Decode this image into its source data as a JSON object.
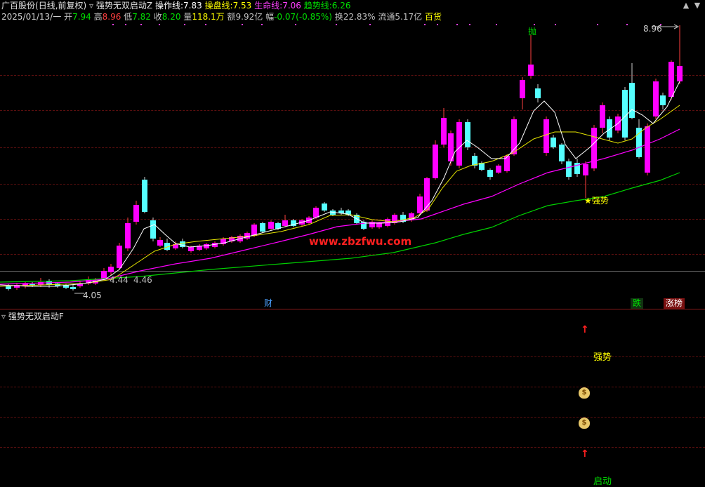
{
  "header": {
    "stock": "广百股份",
    "mode": "(日线,前复权)",
    "indicator_name": "强势无双启动Z",
    "lines": [
      {
        "label": "操作线:",
        "value": "7.83",
        "color": "#ffffff"
      },
      {
        "label": "操盘线:",
        "value": "7.53",
        "color": "#ffff00"
      },
      {
        "label": "生命线:",
        "value": "7.06",
        "color": "#ff40ff"
      },
      {
        "label": "趋势线:",
        "value": "6.26",
        "color": "#00e000"
      }
    ]
  },
  "quote": {
    "date": "2025/01/13/一",
    "open_label": "开",
    "open": "7.94",
    "high_label": "高",
    "high": "8.96",
    "low_label": "低",
    "low": "7.82",
    "close_label": "收",
    "close": "8.20",
    "volume_label": "量",
    "volume": "118.1万",
    "amount_label": "额",
    "amount": "9.92亿",
    "change_label": "幅",
    "change": "-0.07(-0.85%)",
    "turnover_label": "换",
    "turnover": "22.83%",
    "float_label": "流通",
    "float": "5.17亿",
    "sector": "百货"
  },
  "chart": {
    "high_marker": "8.96",
    "low_marker": "4.05",
    "mid_label_1": "4.44",
    "mid_label_2": "4.46",
    "pao_label": "抛",
    "strong_label": "★强势",
    "watermark": "www.zbzfwu.com"
  },
  "events": {
    "cai": "财",
    "die": "跌",
    "zhangbang": "涨榜"
  },
  "subchart": {
    "title": "强势无双启动F",
    "strong_text": "强势",
    "start_text": "启动"
  },
  "colors": {
    "up": "#ff00ff",
    "down": "#55ffff",
    "ma_white": "#ffffff",
    "ma_yellow": "#ffff00",
    "ma_magenta": "#ff00ff",
    "ma_green": "#00d000"
  },
  "chart_data": {
    "type": "candlestick",
    "period": "daily",
    "lines": [
      {
        "name": "操作线",
        "value": 7.83
      },
      {
        "name": "操盘线",
        "value": 7.53
      },
      {
        "name": "生命线",
        "value": 7.06
      },
      {
        "name": "趋势线",
        "value": 6.26
      }
    ],
    "visible_price_labels": [
      8.96,
      4.05,
      4.44,
      4.46
    ],
    "last_bar": {
      "open": 7.94,
      "high": 8.96,
      "low": 7.82,
      "close": 8.2
    }
  }
}
